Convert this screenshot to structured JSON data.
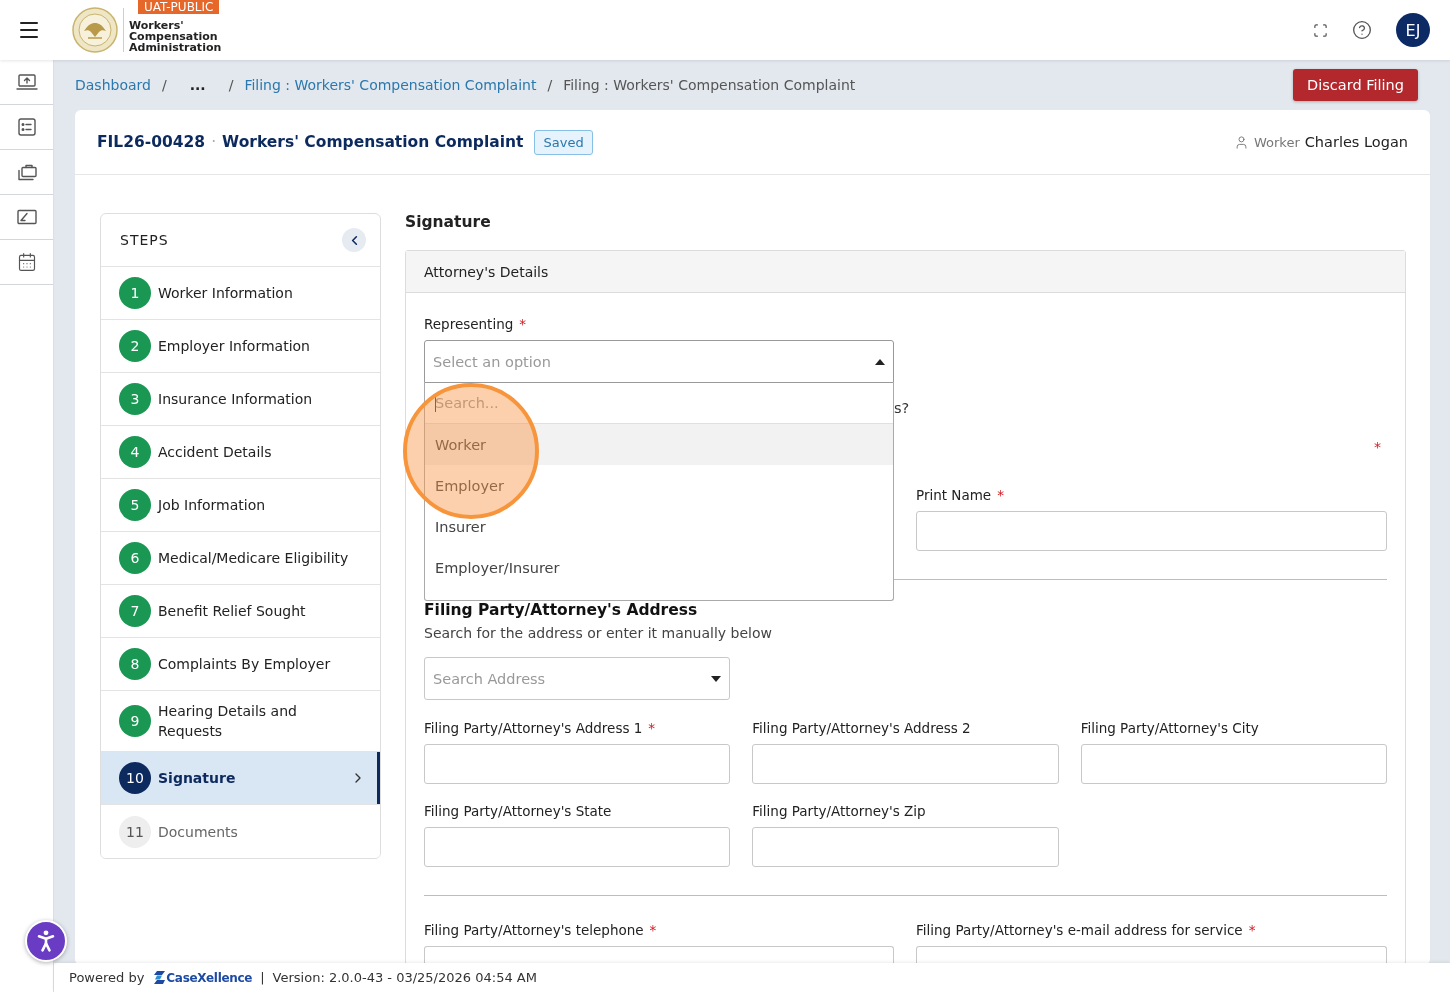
{
  "header": {
    "badge": "UAT-PUBLIC",
    "logo_lines": [
      "Workers'",
      "Compensation",
      "Administration"
    ],
    "avatar": "EJ"
  },
  "breadcrumb": [
    {
      "kind": "link",
      "label": "Dashboard"
    },
    {
      "kind": "separator",
      "label": "/"
    },
    {
      "kind": "ellipsis",
      "label": "..."
    },
    {
      "kind": "separator",
      "label": "/"
    },
    {
      "kind": "link",
      "label": "Filing : Workers' Compensation Complaint"
    },
    {
      "kind": "separator",
      "label": "/"
    },
    {
      "kind": "current",
      "label": "Filing : Workers' Compensation Complaint"
    }
  ],
  "discard_button": "Discard Filing",
  "filing": {
    "number": "FIL26-00428",
    "separator": "·",
    "title": "Workers' Compensation Complaint",
    "status": "Saved",
    "party_label": "Worker",
    "party_name": "Charles Logan"
  },
  "steps": {
    "title": "STEPS",
    "items": [
      {
        "number": "1",
        "label": "Worker Information",
        "completed": true,
        "selected": false
      },
      {
        "number": "2",
        "label": "Employer Information",
        "completed": true,
        "selected": false
      },
      {
        "number": "3",
        "label": "Insurance Information",
        "completed": true,
        "selected": false
      },
      {
        "number": "4",
        "label": "Accident Details",
        "completed": true,
        "selected": false
      },
      {
        "number": "5",
        "label": "Job Information",
        "completed": true,
        "selected": false
      },
      {
        "number": "6",
        "label": "Medical/Medicare Eligibility",
        "completed": true,
        "selected": false
      },
      {
        "number": "7",
        "label": "Benefit Relief Sought",
        "completed": true,
        "selected": false
      },
      {
        "number": "8",
        "label": "Complaints By Employer",
        "completed": true,
        "selected": false
      },
      {
        "number": "9",
        "label": "Hearing Details and Requests",
        "completed": true,
        "selected": false
      },
      {
        "number": "10",
        "label": "Signature",
        "completed": false,
        "selected": true
      },
      {
        "number": "11",
        "label": "Documents",
        "completed": false,
        "selected": false
      }
    ]
  },
  "form": {
    "heading": "Signature",
    "section": "Attorney's Details",
    "representing": {
      "label": "Representing",
      "mark": "*",
      "placeholder": "Select an option",
      "expanded": true,
      "search_placeholder": "Search...",
      "options": [
        {
          "label": "Worker",
          "highlighted": true
        },
        {
          "label": "Employer",
          "highlighted": false
        },
        {
          "label": "Insurer",
          "highlighted": false
        },
        {
          "label": "Employer/Insurer",
          "highlighted": false
        }
      ]
    },
    "hidden_question_end": "s?",
    "hidden_field_mark": "*",
    "print_name": {
      "label": "Print Name",
      "mark": "*"
    },
    "address": {
      "title": "Filing Party/Attorney's Address",
      "subtitle": "Search for the address or enter it manually below",
      "search_placeholder": "Search Address",
      "fields": [
        {
          "label": "Filing Party/Attorney's Address 1",
          "mark": "*"
        },
        {
          "label": "Filing Party/Attorney's Address 2"
        },
        {
          "label": "Filing Party/Attorney's City"
        },
        {
          "label": "Filing Party/Attorney's State"
        },
        {
          "label": "Filing Party/Attorney's Zip"
        }
      ]
    },
    "contact_fields": [
      {
        "label": "Filing Party/Attorney's telephone",
        "mark": "*"
      },
      {
        "label": "Filing Party/Attorney's e-mail address for service",
        "mark": "*"
      }
    ]
  },
  "footer": {
    "powered_by": "Powered by",
    "brand": "CaseXellence",
    "divider": "|",
    "version": "Version: 2.0.0-43 - 03/25/2026 04:54 AM"
  }
}
